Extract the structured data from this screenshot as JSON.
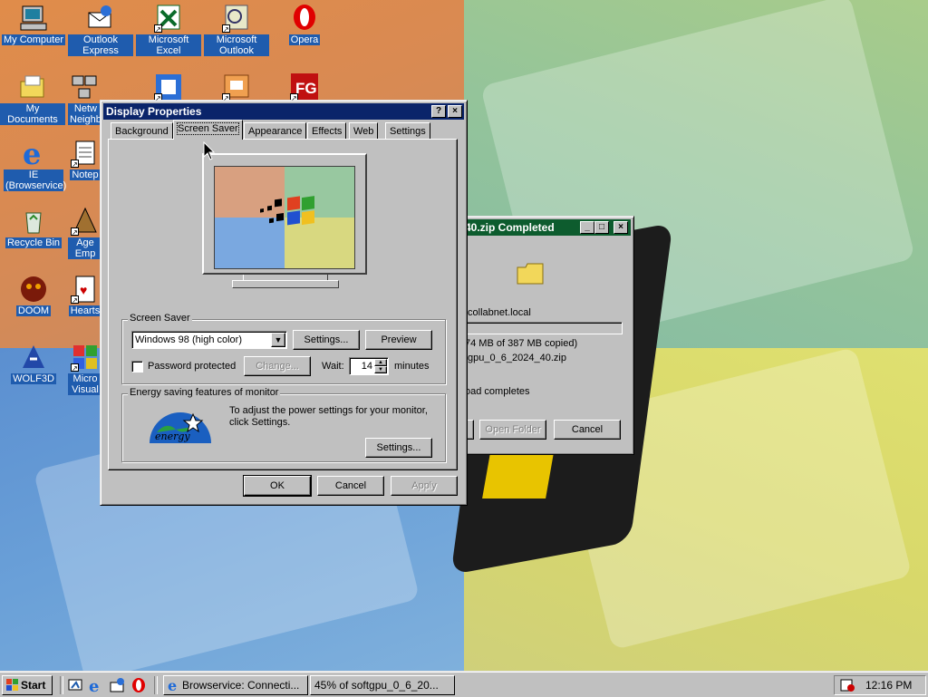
{
  "desktop_icons": [
    {
      "id": "my-computer",
      "label": "My Computer",
      "icon": "computer-icon",
      "shortcut": false
    },
    {
      "id": "outlook-express",
      "label": "Outlook Express",
      "icon": "outlook-express-icon",
      "shortcut": false
    },
    {
      "id": "microsoft-excel",
      "label": "Microsoft Excel",
      "icon": "excel-icon",
      "shortcut": true
    },
    {
      "id": "microsoft-outlook",
      "label": "Microsoft Outlook",
      "icon": "outlook-icon",
      "shortcut": true
    },
    {
      "id": "opera",
      "label": "Opera",
      "icon": "opera-icon",
      "shortcut": false
    },
    {
      "id": "my-documents",
      "label": "My Documents",
      "icon": "folder-icon",
      "shortcut": false
    },
    {
      "id": "network-neighborhood",
      "label": "Netw Neighb",
      "icon": "network-icon",
      "shortcut": false
    },
    {
      "id": "ie-browservice",
      "label": "IE (Browservice)",
      "icon": "ie-icon",
      "shortcut": false
    },
    {
      "id": "notepad",
      "label": "Notep",
      "icon": "notepad-icon",
      "shortcut": true
    },
    {
      "id": "recycle-bin",
      "label": "Recycle Bin",
      "icon": "recycle-bin-icon",
      "shortcut": false
    },
    {
      "id": "age-of-empires",
      "label": "Age Emp",
      "icon": "age-of-empires-icon",
      "shortcut": true
    },
    {
      "id": "doom",
      "label": "DOOM",
      "icon": "doom-icon",
      "shortcut": false
    },
    {
      "id": "hearts",
      "label": "Hearts",
      "icon": "hearts-icon",
      "shortcut": true
    },
    {
      "id": "wolf3d",
      "label": "WOLF3D",
      "icon": "wolf3d-icon",
      "shortcut": false
    },
    {
      "id": "microsoft-visual",
      "label": "Micro Visual",
      "icon": "visual-studio-icon",
      "shortcut": true
    }
  ],
  "display_properties": {
    "title": "Display Properties",
    "help_button": "?",
    "close_button": "×",
    "tabs": [
      "Background",
      "Screen Saver",
      "Appearance",
      "Effects",
      "Web",
      "Settings"
    ],
    "selected_tab": "Screen Saver",
    "screen_saver_group": "Screen Saver",
    "screen_saver_value": "Windows 98 (high color)",
    "settings_button": "Settings...",
    "preview_button": "Preview",
    "password_protected_label": "Password protected",
    "password_protected_checked": false,
    "change_button": "Change...",
    "wait_label": "Wait:",
    "wait_value": "14",
    "minutes_label": "minutes",
    "energy_group": "Energy saving features of monitor",
    "energy_text": "To adjust the power settings for your monitor, click Settings.",
    "energy_settings_button": "Settings...",
    "energy_star_text": "energy",
    "ok_button": "OK",
    "cancel_button": "Cancel",
    "apply_button": "Apply"
  },
  "download_dialog": {
    "title": "40.zip Completed",
    "source": ".collabnet.local",
    "progress_text": "74 MB of 387 MB copied)",
    "file_text": "tgpu_0_6_2024_40.zip",
    "status_text": "oad completes",
    "open_folder_button": "Open Folder",
    "cancel_button": "Cancel"
  },
  "taskbar": {
    "start_label": "Start",
    "quick_launch": [
      "desktop-icon",
      "ie-icon",
      "outlook-express-icon",
      "opera-icon"
    ],
    "tasks": [
      {
        "label": "Browservice: Connecti...",
        "icon": "ie-icon"
      },
      {
        "label": "45% of softgpu_0_6_20...",
        "icon": "download-icon"
      }
    ],
    "clock": "12:16 PM"
  },
  "colors": {
    "title_active": "#0a246a",
    "title_inactive_green": "#0d5c2e",
    "face": "#c0c0c0",
    "icon_label_bg": "#1f5cae"
  }
}
